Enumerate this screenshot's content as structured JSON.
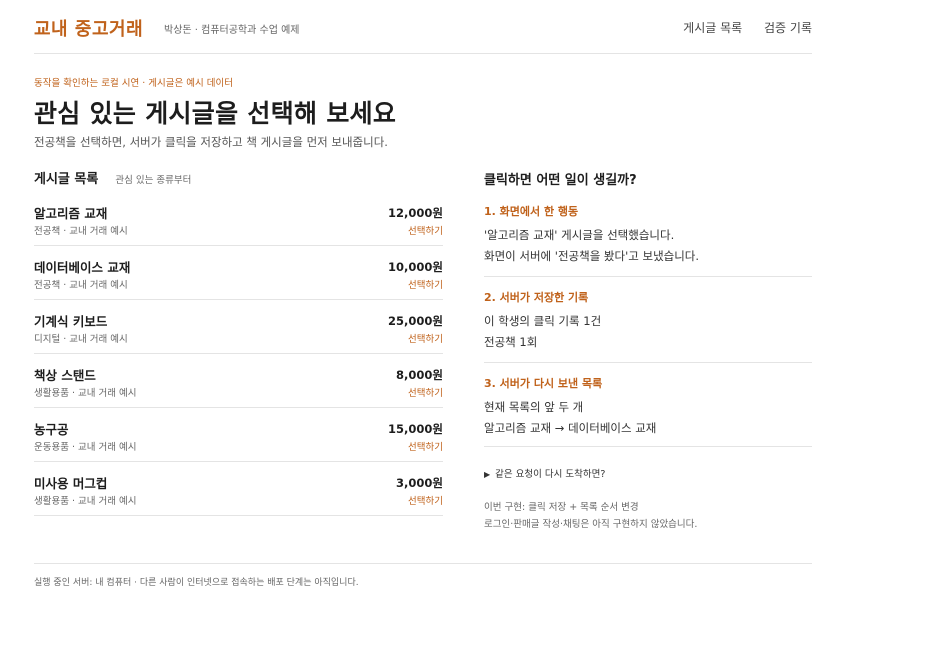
{
  "header": {
    "brand": "교내 중고거래",
    "subtitle": "박상돈 · 컴퓨터공학과 수업 예제",
    "nav": [
      {
        "label": "게시글 목록"
      },
      {
        "label": "검증 기록"
      }
    ]
  },
  "intro": {
    "eyebrow": "동작을 확인하는 로컬 시연 · 게시글은 예시 데이터",
    "title": "관심 있는 게시글을 선택해 보세요",
    "description": "전공책을 선택하면, 서버가 클릭을 저장하고 책 게시글을 먼저 보내줍니다."
  },
  "list": {
    "title": "게시글 목록",
    "hint": "관심 있는 종류부터",
    "items": [
      {
        "name": "알고리즘 교재",
        "meta": "전공책 · 교내 거래 예시",
        "price": "12,000원",
        "action": "선택하기"
      },
      {
        "name": "데이터베이스 교재",
        "meta": "전공책 · 교내 거래 예시",
        "price": "10,000원",
        "action": "선택하기"
      },
      {
        "name": "기계식 키보드",
        "meta": "디지털 · 교내 거래 예시",
        "price": "25,000원",
        "action": "선택하기"
      },
      {
        "name": "책상 스탠드",
        "meta": "생활용품 · 교내 거래 예시",
        "price": "8,000원",
        "action": "선택하기"
      },
      {
        "name": "농구공",
        "meta": "운동용품 · 교내 거래 예시",
        "price": "15,000원",
        "action": "선택하기"
      },
      {
        "name": "미사용 머그컵",
        "meta": "생활용품 · 교내 거래 예시",
        "price": "3,000원",
        "action": "선택하기"
      }
    ]
  },
  "panel": {
    "title": "클릭하면 어떤 일이 생길까?",
    "steps": [
      {
        "label": "1. 화면에서 한 행동",
        "lines": [
          "'알고리즘 교재' 게시글을 선택했습니다.",
          "화면이 서버에 '전공책을 봤다'고 보냈습니다."
        ]
      },
      {
        "label": "2. 서버가 저장한 기록",
        "lines": [
          "이 학생의 클릭 기록 1건",
          "전공책 1회"
        ]
      },
      {
        "label": "3. 서버가 다시 보낸 목록",
        "lines": [
          "현재 목록의 앞 두 개",
          "알고리즘 교재 → 데이터베이스 교재"
        ]
      }
    ],
    "details_summary": "같은 요청이 다시 도착하면?",
    "notes": [
      "이번 구현: 클릭 저장 + 목록 순서 변경",
      "로그인·판매글 작성·채팅은 아직 구현하지 않았습니다."
    ]
  },
  "footer": {
    "text": "실행 중인 서버: 내 컴퓨터 · 다른 사람이 인터넷으로 접속하는 배포 단계는 아직입니다."
  },
  "colors": {
    "accent": "#c0621b",
    "text": "#1d1d1d",
    "muted": "#666666",
    "divider": "#e4e4e4"
  }
}
